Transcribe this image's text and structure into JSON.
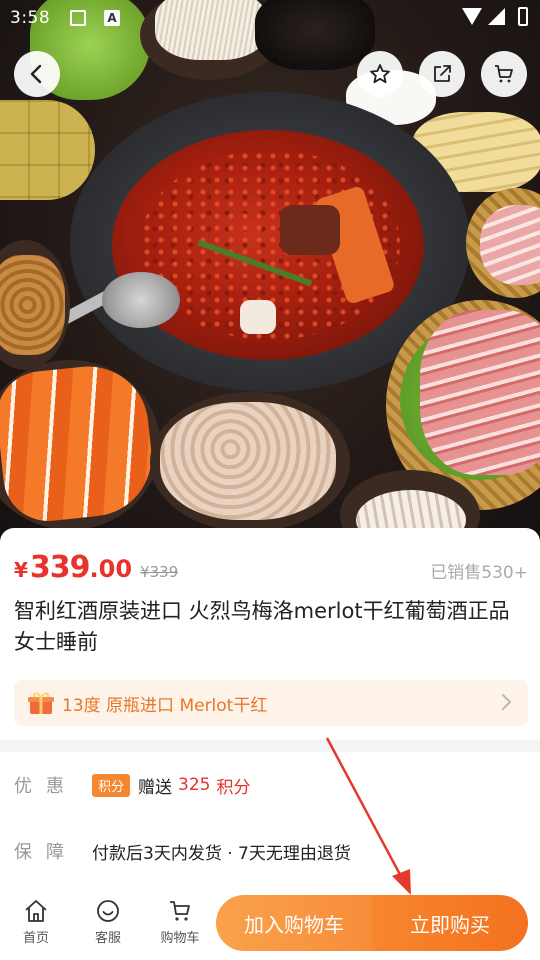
{
  "status_bar": {
    "time": "3:58",
    "a_icon_letter": "A"
  },
  "hero": {
    "photo_subject": "hotpot-feast"
  },
  "nav": {
    "back_icon": "arrow-left-icon",
    "fav_icon": "star-icon",
    "share_icon": "share-icon",
    "cart_icon": "cart-icon"
  },
  "product": {
    "currency": "¥",
    "price_int": "339",
    "price_dec": ".00",
    "original_price": "¥339",
    "sold": "已销售530+",
    "title": "智利红酒原装进口 火烈鸟梅洛merlot干红葡萄酒正品女士睡前",
    "promo": "13度 原瓶进口 Merlot干红"
  },
  "info": {
    "discount_label": "优惠",
    "points_badge": "积分",
    "gift_prefix": "赠送",
    "gift_amount": "325",
    "gift_suffix": "积分",
    "guarantee_label": "保障",
    "guarantee_text": "付款后3天内发货 · 7天无理由退货"
  },
  "bottom_bar": {
    "home": "首页",
    "service": "客服",
    "cart": "购物车",
    "add_to_cart": "加入购物车",
    "buy_now": "立即购买"
  },
  "colors": {
    "price_red": "#e8322b",
    "accent_orange": "#f4872f",
    "annotation": "#e23a2c"
  }
}
